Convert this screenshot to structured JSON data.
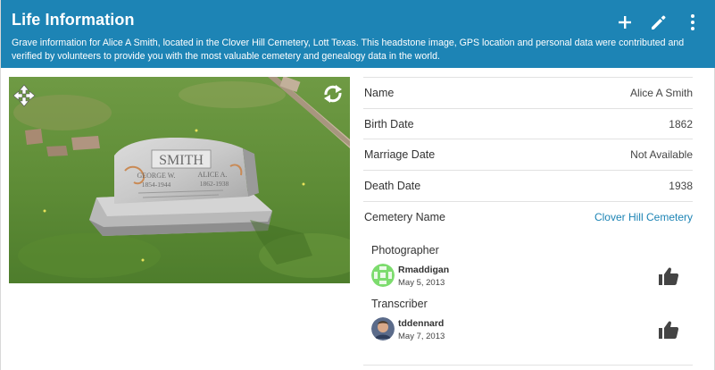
{
  "header": {
    "title": "Life Information",
    "description": "Grave information for Alice A Smith, located in the Clover Hill Cemetery, Lott Texas. This headstone image, GPS location and personal data were contributed and verified by volunteers to provide you with the most valuable cemetery and genealogy data in the world.",
    "actions": [
      {
        "name": "add",
        "icon": "plus-icon"
      },
      {
        "name": "edit",
        "icon": "pencil-icon"
      },
      {
        "name": "more",
        "icon": "more-vertical-icon"
      }
    ]
  },
  "photo": {
    "stone_name": "SMITH",
    "left_name": "GEORGE W.",
    "left_years": "1854-1944",
    "right_name": "ALICE A.",
    "right_years": "1862-1938",
    "move_icon": "move-arrows-icon",
    "rotate_icon": "rotate-icon"
  },
  "details": {
    "rows": [
      {
        "label": "Name",
        "value": "Alice A Smith"
      },
      {
        "label": "Birth Date",
        "value": "1862"
      },
      {
        "label": "Marriage Date",
        "value": "Not Available"
      },
      {
        "label": "Death Date",
        "value": "1938"
      },
      {
        "label": "Cemetery Name",
        "value": "Clover Hill Cemetery"
      }
    ]
  },
  "contributors": {
    "photographer": {
      "title": "Photographer",
      "user": "Rmaddigan",
      "date": "May 5, 2013"
    },
    "transcriber": {
      "title": "Transcriber",
      "user": "tddennard",
      "date": "May 7, 2013"
    }
  },
  "colors": {
    "header_bg": "#1d84b5",
    "link": "#1d84b5",
    "avatar_green": "#7ddc6e"
  }
}
